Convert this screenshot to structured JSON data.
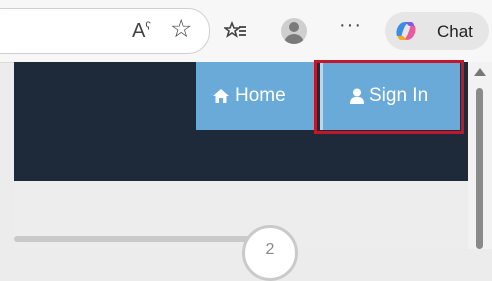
{
  "browser": {
    "read_aloud_glyph": "A",
    "read_aloud_sup": "ʕ",
    "favorite_glyph": "☆",
    "collections_glyph": "≡",
    "more_glyph": "···",
    "chat_label": "Chat"
  },
  "navbar": {
    "home_icon": "⌂",
    "home_label": "Home",
    "signin_icon": "▲",
    "signin_label": "Sign In"
  },
  "stepper": {
    "step_label": "2"
  }
}
